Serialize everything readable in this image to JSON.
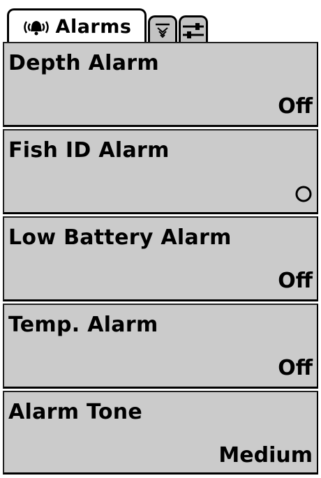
{
  "tabs": [
    {
      "label": "Alarms",
      "icon": "alarm-bell-icon",
      "active": true
    },
    {
      "label": "",
      "icon": "sonar-icon",
      "active": false
    },
    {
      "label": "",
      "icon": "settings-sliders-icon",
      "active": false
    }
  ],
  "menu": {
    "items": [
      {
        "label": "Depth Alarm",
        "value": "Off"
      },
      {
        "label": "Fish ID Alarm",
        "value": "",
        "value_icon": "fish-symbol-icon"
      },
      {
        "label": "Low Battery Alarm",
        "value": "Off"
      },
      {
        "label": "Temp. Alarm",
        "value": "Off"
      },
      {
        "label": "Alarm Tone",
        "value": "Medium"
      }
    ]
  },
  "colors": {
    "item_background": "#cbcbcb",
    "inactive_tab": "#c3c3c3",
    "text": "#000000"
  }
}
